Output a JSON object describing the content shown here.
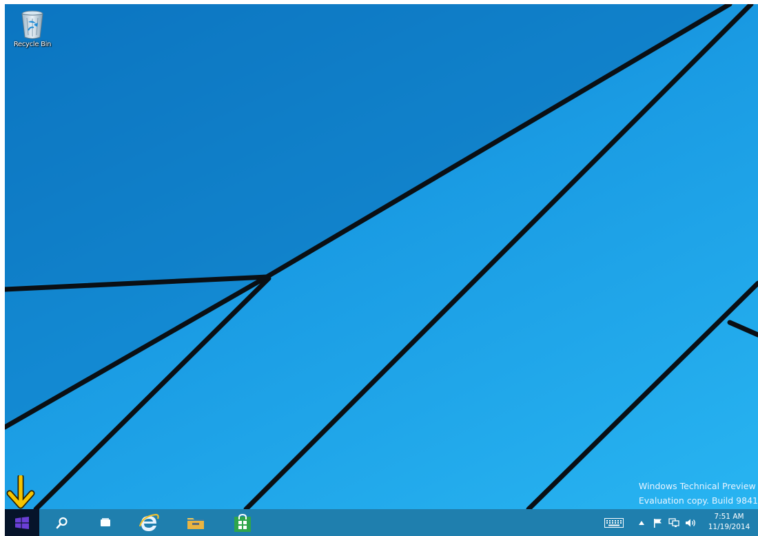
{
  "desktop": {
    "icons": [
      {
        "label": "Recycle Bin",
        "icon": "recycle-bin-icon"
      }
    ],
    "watermark": {
      "line1": "Windows Technical Preview",
      "line2": "Evaluation copy. Build 9841"
    }
  },
  "annotation": {
    "icon": "arrow-down-icon",
    "color": "#f5c400"
  },
  "taskbar": {
    "buttons": [
      {
        "name": "start",
        "icon": "windows-logo-icon"
      },
      {
        "name": "search",
        "icon": "search-icon"
      },
      {
        "name": "task-view",
        "icon": "task-view-icon"
      },
      {
        "name": "internet-explorer",
        "icon": "internet-explorer-icon"
      },
      {
        "name": "file-explorer",
        "icon": "folder-icon"
      },
      {
        "name": "store",
        "icon": "store-icon"
      }
    ],
    "tray": {
      "icons": [
        "keyboard-icon",
        "chevron-up-icon",
        "flag-icon",
        "network-icon",
        "volume-icon"
      ],
      "time": "7:51 AM",
      "date": "11/19/2014"
    }
  },
  "colors": {
    "taskbar": "#1f7fae",
    "start_button": "#06142a",
    "windows_logo": "#6b3fd6",
    "wallpaper": "#1a9be3"
  }
}
